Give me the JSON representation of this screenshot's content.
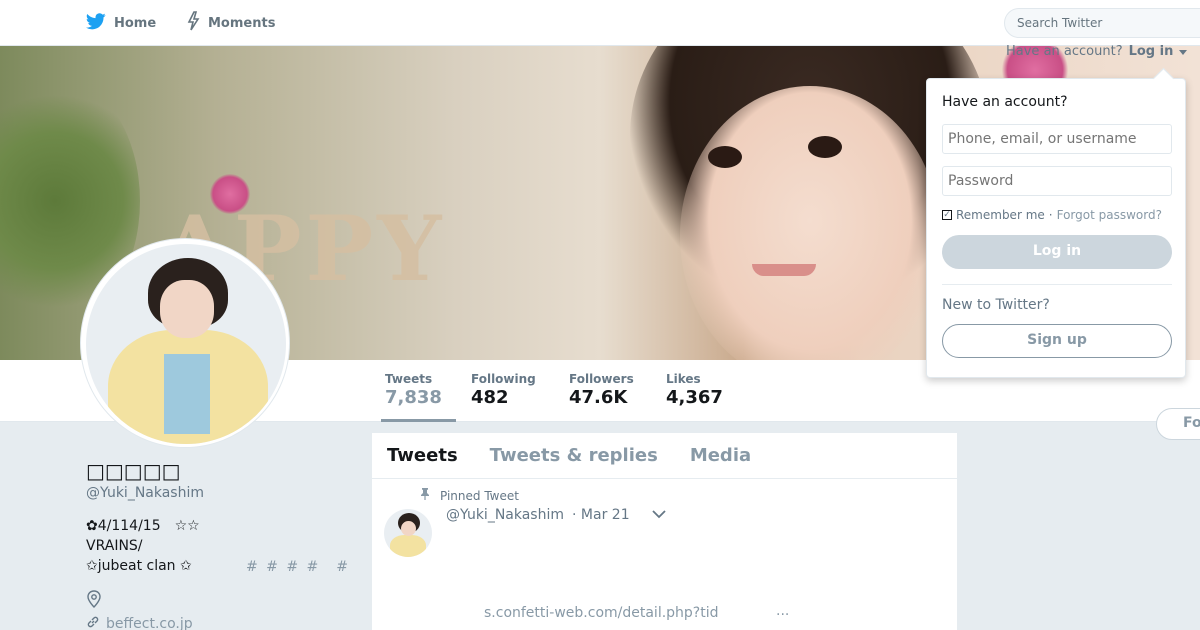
{
  "nav": {
    "home_label": "Home",
    "moments_label": "Moments",
    "search_placeholder": "Search Twitter",
    "icons": [
      "twitter-bird-icon",
      "lightning-icon"
    ]
  },
  "account": {
    "have_account": "Have an account?",
    "login_link": "Log in",
    "dropdown": {
      "title": "Have an account?",
      "username_placeholder": "Phone, email, or username",
      "password_placeholder": "Password",
      "remember_me": "Remember me",
      "separator": "·",
      "forgot_password": "Forgot password?",
      "login_button": "Log in",
      "new_prompt": "New to Twitter?",
      "signup_button": "Sign up"
    }
  },
  "profile": {
    "name": "□□□□□",
    "handle": "@Yuki_Nakashim",
    "bio_line1": "✿4/114/15　☆☆",
    "bio_line2": "VRAINS/",
    "bio_line3": "✩jubeat clan ✩",
    "bio_hashtags": "# # # #　#",
    "link": "beffect.co.jp",
    "follow_button": "Fo"
  },
  "stats": [
    {
      "label": "Tweets",
      "value": "7,838"
    },
    {
      "label": "Following",
      "value": "482"
    },
    {
      "label": "Followers",
      "value": "47.6K"
    },
    {
      "label": "Likes",
      "value": "4,367"
    }
  ],
  "timeline": {
    "tabs": [
      "Tweets",
      "Tweets & replies",
      "Media"
    ],
    "pinned_label": "Pinned Tweet",
    "tweet": {
      "handle": "@Yuki_Nakashim",
      "date": "· Mar 21",
      "link_text": "s.confetti-web.com/detail.php?tid",
      "ellipsis": "..."
    }
  },
  "colors": {
    "accent": "#1da1f2",
    "muted": "#8899a6",
    "text": "#14171a",
    "page_bg": "#e6ecf0"
  }
}
